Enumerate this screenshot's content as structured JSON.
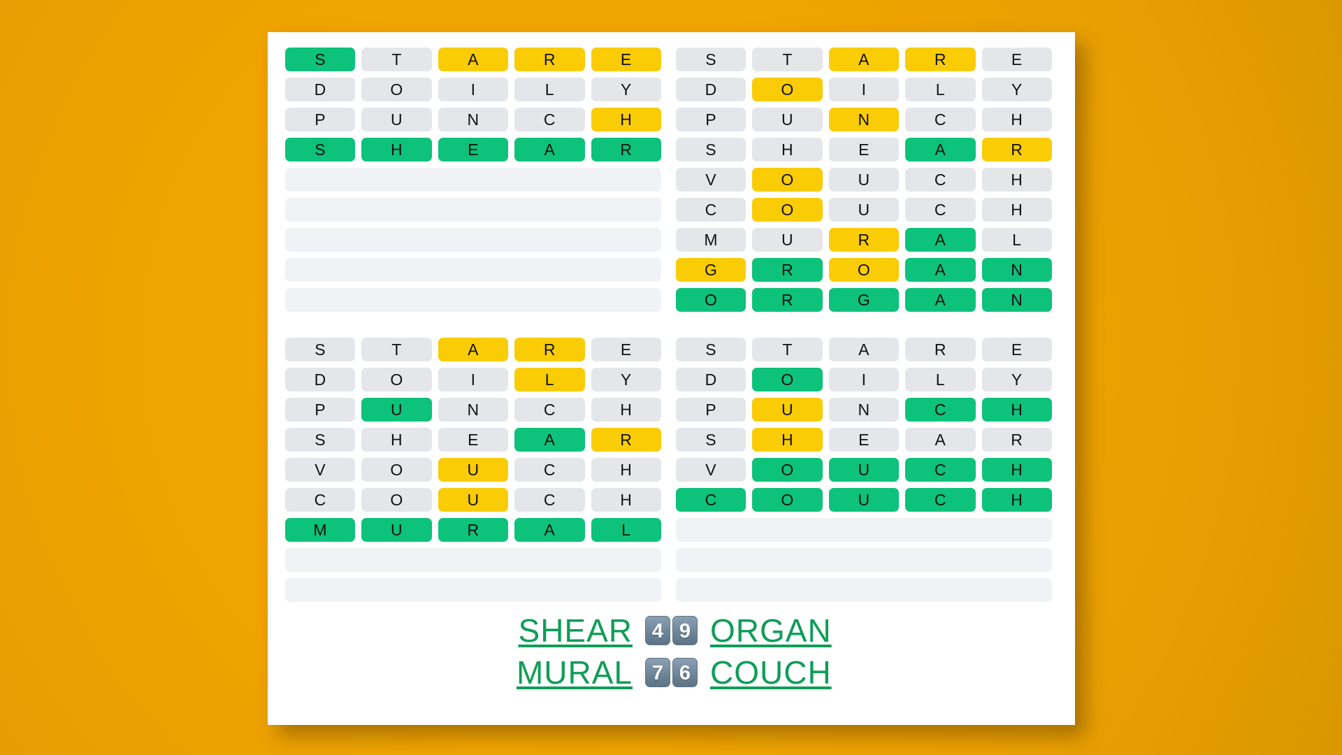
{
  "background_color": "#f0a500",
  "card_color": "#ffffff",
  "colors": {
    "green": "#0dc27b",
    "yellow": "#facc05",
    "gray": "#e4e6ea",
    "empty": "#f0f2f6",
    "answer_text": "#0f9d58",
    "badge": "#6f8699"
  },
  "boards": [
    {
      "name": "board-top-left",
      "rows": [
        [
          {
            "letter": "S",
            "state": "green"
          },
          {
            "letter": "T",
            "state": "gray"
          },
          {
            "letter": "A",
            "state": "yellow"
          },
          {
            "letter": "R",
            "state": "yellow"
          },
          {
            "letter": "E",
            "state": "yellow"
          }
        ],
        [
          {
            "letter": "D",
            "state": "gray"
          },
          {
            "letter": "O",
            "state": "gray"
          },
          {
            "letter": "I",
            "state": "gray"
          },
          {
            "letter": "L",
            "state": "gray"
          },
          {
            "letter": "Y",
            "state": "gray"
          }
        ],
        [
          {
            "letter": "P",
            "state": "gray"
          },
          {
            "letter": "U",
            "state": "gray"
          },
          {
            "letter": "N",
            "state": "gray"
          },
          {
            "letter": "C",
            "state": "gray"
          },
          {
            "letter": "H",
            "state": "yellow"
          }
        ],
        [
          {
            "letter": "S",
            "state": "green"
          },
          {
            "letter": "H",
            "state": "green"
          },
          {
            "letter": "E",
            "state": "green"
          },
          {
            "letter": "A",
            "state": "green"
          },
          {
            "letter": "R",
            "state": "green"
          }
        ],
        "empty",
        "empty",
        "empty",
        "empty",
        "empty"
      ]
    },
    {
      "name": "board-top-right",
      "rows": [
        [
          {
            "letter": "S",
            "state": "gray"
          },
          {
            "letter": "T",
            "state": "gray"
          },
          {
            "letter": "A",
            "state": "yellow"
          },
          {
            "letter": "R",
            "state": "yellow"
          },
          {
            "letter": "E",
            "state": "gray"
          }
        ],
        [
          {
            "letter": "D",
            "state": "gray"
          },
          {
            "letter": "O",
            "state": "yellow"
          },
          {
            "letter": "I",
            "state": "gray"
          },
          {
            "letter": "L",
            "state": "gray"
          },
          {
            "letter": "Y",
            "state": "gray"
          }
        ],
        [
          {
            "letter": "P",
            "state": "gray"
          },
          {
            "letter": "U",
            "state": "gray"
          },
          {
            "letter": "N",
            "state": "yellow"
          },
          {
            "letter": "C",
            "state": "gray"
          },
          {
            "letter": "H",
            "state": "gray"
          }
        ],
        [
          {
            "letter": "S",
            "state": "gray"
          },
          {
            "letter": "H",
            "state": "gray"
          },
          {
            "letter": "E",
            "state": "gray"
          },
          {
            "letter": "A",
            "state": "green"
          },
          {
            "letter": "R",
            "state": "yellow"
          }
        ],
        [
          {
            "letter": "V",
            "state": "gray"
          },
          {
            "letter": "O",
            "state": "yellow"
          },
          {
            "letter": "U",
            "state": "gray"
          },
          {
            "letter": "C",
            "state": "gray"
          },
          {
            "letter": "H",
            "state": "gray"
          }
        ],
        [
          {
            "letter": "C",
            "state": "gray"
          },
          {
            "letter": "O",
            "state": "yellow"
          },
          {
            "letter": "U",
            "state": "gray"
          },
          {
            "letter": "C",
            "state": "gray"
          },
          {
            "letter": "H",
            "state": "gray"
          }
        ],
        [
          {
            "letter": "M",
            "state": "gray"
          },
          {
            "letter": "U",
            "state": "gray"
          },
          {
            "letter": "R",
            "state": "yellow"
          },
          {
            "letter": "A",
            "state": "green"
          },
          {
            "letter": "L",
            "state": "gray"
          }
        ],
        [
          {
            "letter": "G",
            "state": "yellow"
          },
          {
            "letter": "R",
            "state": "green"
          },
          {
            "letter": "O",
            "state": "yellow"
          },
          {
            "letter": "A",
            "state": "green"
          },
          {
            "letter": "N",
            "state": "green"
          }
        ],
        [
          {
            "letter": "O",
            "state": "green"
          },
          {
            "letter": "R",
            "state": "green"
          },
          {
            "letter": "G",
            "state": "green"
          },
          {
            "letter": "A",
            "state": "green"
          },
          {
            "letter": "N",
            "state": "green"
          }
        ]
      ]
    },
    {
      "name": "board-bottom-left",
      "rows": [
        [
          {
            "letter": "S",
            "state": "gray"
          },
          {
            "letter": "T",
            "state": "gray"
          },
          {
            "letter": "A",
            "state": "yellow"
          },
          {
            "letter": "R",
            "state": "yellow"
          },
          {
            "letter": "E",
            "state": "gray"
          }
        ],
        [
          {
            "letter": "D",
            "state": "gray"
          },
          {
            "letter": "O",
            "state": "gray"
          },
          {
            "letter": "I",
            "state": "gray"
          },
          {
            "letter": "L",
            "state": "yellow"
          },
          {
            "letter": "Y",
            "state": "gray"
          }
        ],
        [
          {
            "letter": "P",
            "state": "gray"
          },
          {
            "letter": "U",
            "state": "green"
          },
          {
            "letter": "N",
            "state": "gray"
          },
          {
            "letter": "C",
            "state": "gray"
          },
          {
            "letter": "H",
            "state": "gray"
          }
        ],
        [
          {
            "letter": "S",
            "state": "gray"
          },
          {
            "letter": "H",
            "state": "gray"
          },
          {
            "letter": "E",
            "state": "gray"
          },
          {
            "letter": "A",
            "state": "green"
          },
          {
            "letter": "R",
            "state": "yellow"
          }
        ],
        [
          {
            "letter": "V",
            "state": "gray"
          },
          {
            "letter": "O",
            "state": "gray"
          },
          {
            "letter": "U",
            "state": "yellow"
          },
          {
            "letter": "C",
            "state": "gray"
          },
          {
            "letter": "H",
            "state": "gray"
          }
        ],
        [
          {
            "letter": "C",
            "state": "gray"
          },
          {
            "letter": "O",
            "state": "gray"
          },
          {
            "letter": "U",
            "state": "yellow"
          },
          {
            "letter": "C",
            "state": "gray"
          },
          {
            "letter": "H",
            "state": "gray"
          }
        ],
        [
          {
            "letter": "M",
            "state": "green"
          },
          {
            "letter": "U",
            "state": "green"
          },
          {
            "letter": "R",
            "state": "green"
          },
          {
            "letter": "A",
            "state": "green"
          },
          {
            "letter": "L",
            "state": "green"
          }
        ],
        "empty",
        "empty"
      ]
    },
    {
      "name": "board-bottom-right",
      "rows": [
        [
          {
            "letter": "S",
            "state": "gray"
          },
          {
            "letter": "T",
            "state": "gray"
          },
          {
            "letter": "A",
            "state": "gray"
          },
          {
            "letter": "R",
            "state": "gray"
          },
          {
            "letter": "E",
            "state": "gray"
          }
        ],
        [
          {
            "letter": "D",
            "state": "gray"
          },
          {
            "letter": "O",
            "state": "green"
          },
          {
            "letter": "I",
            "state": "gray"
          },
          {
            "letter": "L",
            "state": "gray"
          },
          {
            "letter": "Y",
            "state": "gray"
          }
        ],
        [
          {
            "letter": "P",
            "state": "gray"
          },
          {
            "letter": "U",
            "state": "yellow"
          },
          {
            "letter": "N",
            "state": "gray"
          },
          {
            "letter": "C",
            "state": "green"
          },
          {
            "letter": "H",
            "state": "green"
          }
        ],
        [
          {
            "letter": "S",
            "state": "gray"
          },
          {
            "letter": "H",
            "state": "yellow"
          },
          {
            "letter": "E",
            "state": "gray"
          },
          {
            "letter": "A",
            "state": "gray"
          },
          {
            "letter": "R",
            "state": "gray"
          }
        ],
        [
          {
            "letter": "V",
            "state": "gray"
          },
          {
            "letter": "O",
            "state": "green"
          },
          {
            "letter": "U",
            "state": "green"
          },
          {
            "letter": "C",
            "state": "green"
          },
          {
            "letter": "H",
            "state": "green"
          }
        ],
        [
          {
            "letter": "C",
            "state": "green"
          },
          {
            "letter": "O",
            "state": "green"
          },
          {
            "letter": "U",
            "state": "green"
          },
          {
            "letter": "C",
            "state": "green"
          },
          {
            "letter": "H",
            "state": "green"
          }
        ],
        "empty",
        "empty",
        "empty"
      ]
    }
  ],
  "footer": {
    "rows": [
      {
        "left_word": "SHEAR",
        "scores": [
          "4",
          "9"
        ],
        "right_word": "ORGAN"
      },
      {
        "left_word": "MURAL",
        "scores": [
          "7",
          "6"
        ],
        "right_word": "COUCH"
      }
    ]
  }
}
